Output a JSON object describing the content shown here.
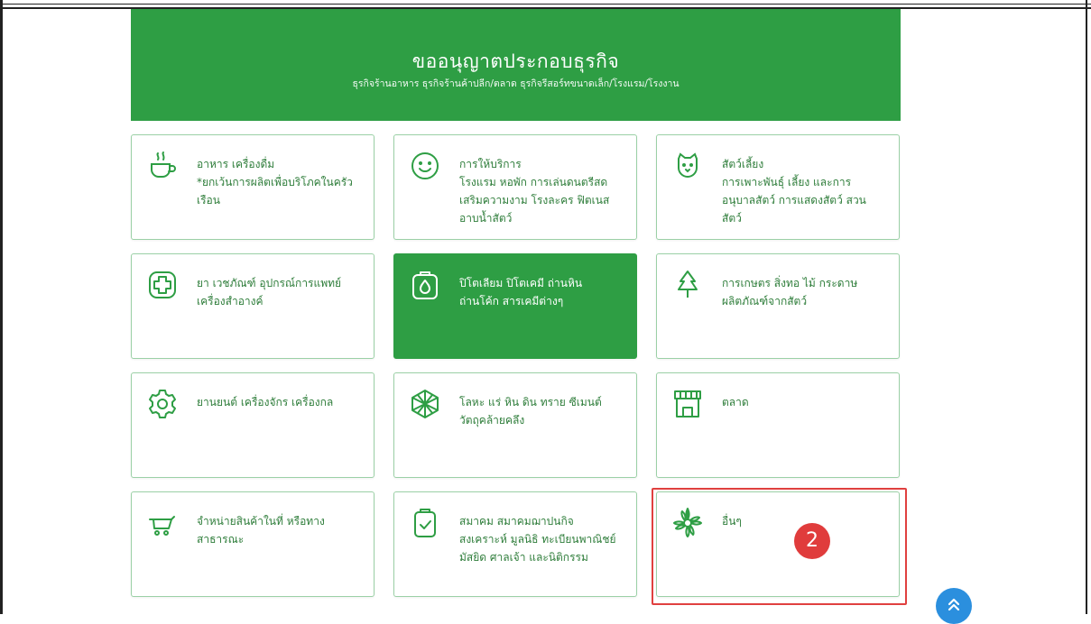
{
  "hero": {
    "title": "ขออนุญาตประกอบธุรกิจ",
    "subtitle": "ธุรกิจร้านอาหาร ธุรกิจร้านค้าปลีก/ตลาด ธุรกิจรีสอร์ทขนาดเล็ก/โรงแรม/โรงงาน",
    "background_color": "#2e9e44"
  },
  "categories": [
    {
      "title": "อาหาร เครื่องดื่ม",
      "desc": "*ยกเว้นการผลิตเพื่อบริโภคในครัวเรือน",
      "icon": "coffee-cup-icon"
    },
    {
      "title": "การให้บริการ",
      "desc": "โรงแรม หอพัก การเล่นดนตรีสด เสริมความงาม โรงละคร ฟิตเนส อาบน้ำสัตว์",
      "icon": "smile-face-icon"
    },
    {
      "title": "สัตว์เลี้ยง",
      "desc": "การเพาะพันธุ์ เลี้ยง และการอนุบาลสัตว์ การแสดงสัตว์ สวนสัตว์",
      "icon": "pet-face-icon"
    },
    {
      "title": "ยา เวชภัณฑ์ อุปกรณ์การแพทย์ เครื่องสำอางค์",
      "desc": "",
      "icon": "medical-cross-icon"
    },
    {
      "title": "ปิโตเลียม ปิโตเคมี ถ่านหิน ถ่านโค้ก สารเคมีต่างๆ",
      "desc": "",
      "icon": "chemical-drop-icon",
      "active": true
    },
    {
      "title": "การเกษตร สิ่งทอ ไม้ กระดาษ ผลิตภัณฑ์จากสัตว์",
      "desc": "",
      "icon": "tree-icon"
    },
    {
      "title": "ยานยนต์ เครื่องจักร เครื่องกล",
      "desc": "",
      "icon": "gear-icon"
    },
    {
      "title": "โลหะ แร่ หิน ดิน ทราย ซีเมนต์ วัตถุคล้ายคลึง",
      "desc": "",
      "icon": "mineral-gem-icon"
    },
    {
      "title": "ตลาด",
      "desc": "",
      "icon": "market-store-icon"
    },
    {
      "title": "จำหน่ายสินค้าในที่ หรือทางสาธารณะ",
      "desc": "",
      "icon": "cart-icon"
    },
    {
      "title": "สมาคม สมาคมฌาปนกิจสงเคราะห์ มูลนิธิ ทะเบียนพาณิชย์ มัสยิด ศาลเจ้า และนิติกรรม",
      "desc": "",
      "icon": "clipboard-check-icon"
    },
    {
      "title": "อื่นๆ",
      "desc": "",
      "icon": "flower-icon"
    }
  ],
  "step_marker": "2",
  "colors": {
    "accent_green": "#2e9e44",
    "card_text": "#2e7d3a",
    "highlight_red": "#e0403f",
    "scroll_blue": "#2b8fde"
  }
}
